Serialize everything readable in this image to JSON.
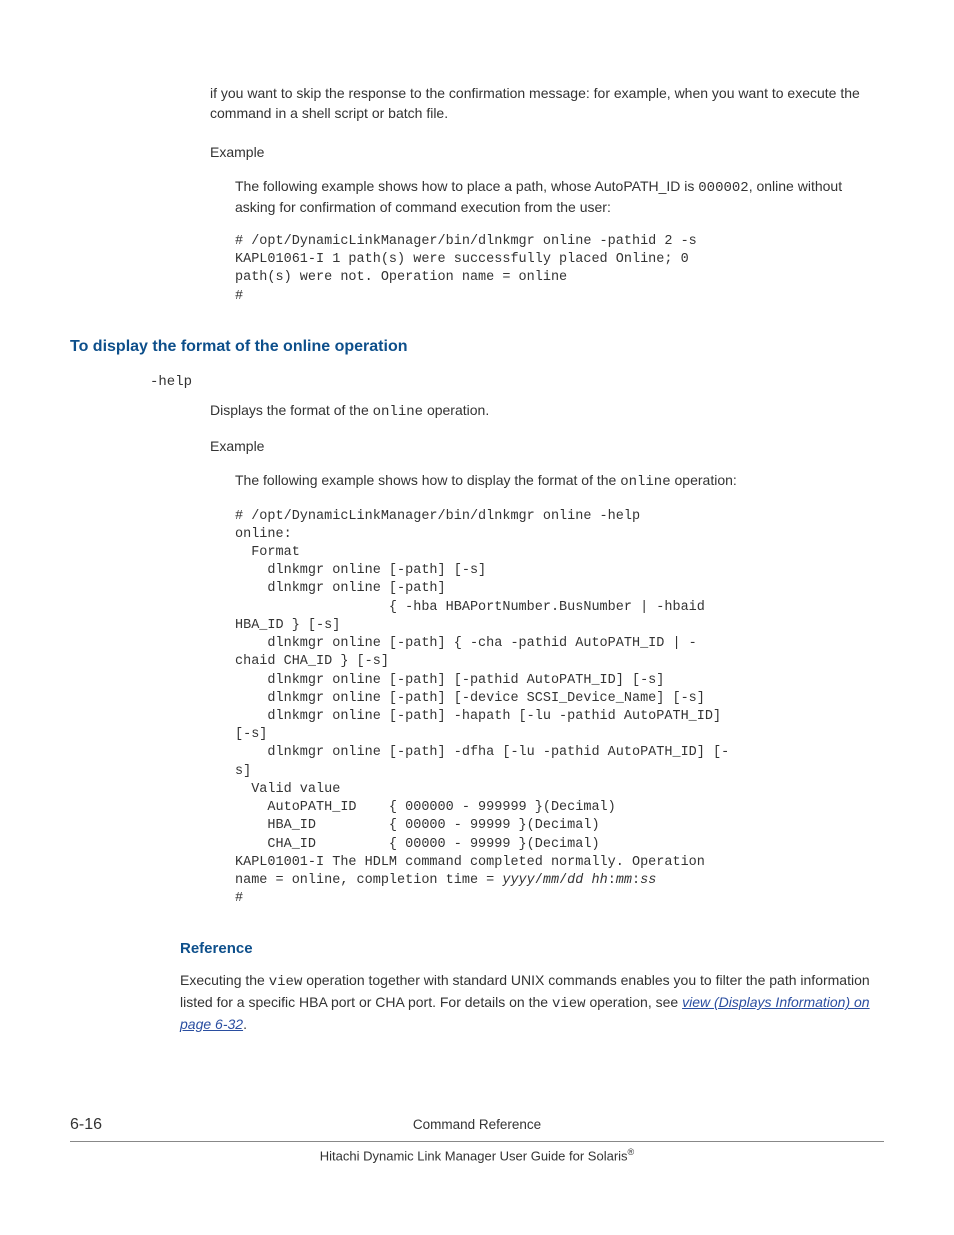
{
  "intro": "if you want to skip the response to the confirmation message: for example, when you want to execute the command in a shell script or batch file.",
  "example_label": "Example",
  "ex1": {
    "pre": "The following example shows how to place a path, whose AutoPATH_ID is ",
    "code_inline": "000002",
    "post": ", online without asking for confirmation of command execution from the user:",
    "code": "# /opt/DynamicLinkManager/bin/dlnkmgr online -pathid 2 -s\nKAPL01061-I 1 path(s) were successfully placed Online; 0\npath(s) were not. Operation name = online\n#"
  },
  "section_heading": "To display the format of the online operation",
  "option": {
    "name": "-help",
    "desc_pre": "Displays the format of the ",
    "desc_code": "online",
    "desc_post": " operation."
  },
  "ex2": {
    "pre": "The following example shows how to display the format of the ",
    "code_inline": "online",
    "post": " operation:",
    "code_part1": "# /opt/DynamicLinkManager/bin/dlnkmgr online -help\nonline:\n  Format\n    dlnkmgr online [-path] [-s]\n    dlnkmgr online [-path]\n                   { -hba HBAPortNumber.BusNumber | -hbaid\nHBA_ID } [-s]\n    dlnkmgr online [-path] { -cha -pathid AutoPATH_ID | -\nchaid CHA_ID } [-s]\n    dlnkmgr online [-path] [-pathid AutoPATH_ID] [-s]\n    dlnkmgr online [-path] [-device SCSI_Device_Name] [-s]\n    dlnkmgr online [-path] -hapath [-lu -pathid AutoPATH_ID]\n[-s]\n    dlnkmgr online [-path] -dfha [-lu -pathid AutoPATH_ID] [-\ns]\n  Valid value\n    AutoPATH_ID    { 000000 - 999999 }(Decimal)\n    HBA_ID         { 00000 - 99999 }(Decimal)\n    CHA_ID         { 00000 - 99999 }(Decimal)\nKAPL01001-I The HDLM command completed normally. Operation\nname = online, completion time = ",
    "code_italic": "yyyy",
    "slash": "/",
    "mm": "mm",
    "dd": "dd",
    "space": " ",
    "hh": "hh",
    "colon": ":",
    "ss": "ss",
    "code_part2": "\n#"
  },
  "reference": {
    "heading": "Reference",
    "p1": "Executing the ",
    "c1": "view",
    "p2": " operation together with standard UNIX commands enables you to filter the path information listed for a specific HBA port or CHA port. For details on the ",
    "c2": "view",
    "p3": " operation, see ",
    "link": "view (Displays Information) on page 6-32",
    "p4": "."
  },
  "footer": {
    "page": "6-16",
    "title1": "Command Reference",
    "title2_pre": "Hitachi Dynamic Link Manager User Guide for Solaris",
    "reg": "®"
  }
}
